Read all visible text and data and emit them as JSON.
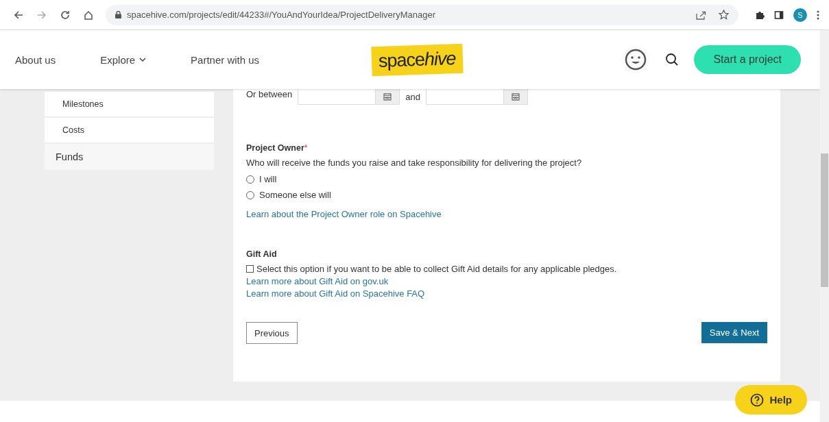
{
  "browser": {
    "url": "spacehive.com/projects/edit/44233#/YouAndYourIdea/ProjectDeliveryManager",
    "profile_initial": "S"
  },
  "header": {
    "nav": [
      {
        "label": "About us",
        "dropdown": false
      },
      {
        "label": "Explore",
        "dropdown": true
      },
      {
        "label": "Partner with us",
        "dropdown": false
      }
    ],
    "logo": {
      "plain": "space",
      "emphasis": "hive"
    },
    "cta": "Start a project"
  },
  "sidebar": {
    "items": [
      {
        "label": "Milestones",
        "kind": "sub"
      },
      {
        "label": "Costs",
        "kind": "sub"
      },
      {
        "label": "Funds",
        "kind": "main"
      }
    ]
  },
  "form": {
    "date_range": {
      "label": "Or between",
      "joiner": "and"
    },
    "project_owner": {
      "title": "Project Owner",
      "required_mark": "*",
      "question": "Who will receive the funds you raise and take responsibility for delivering the project?",
      "options": [
        {
          "label": "I will",
          "selected": false
        },
        {
          "label": "Someone else will",
          "selected": false
        }
      ],
      "link": "Learn about the Project Owner role on Spacehive"
    },
    "gift_aid": {
      "title": "Gift Aid",
      "checkbox": {
        "label": "Select this option if you want to be able to collect Gift Aid details for any applicable pledges.",
        "checked": false
      },
      "links": [
        "Learn more about Gift Aid on gov.uk",
        "Learn more about Gift Aid on Spacehive FAQ"
      ]
    },
    "buttons": {
      "previous": "Previous",
      "next": "Save & Next"
    }
  },
  "help": {
    "label": "Help"
  }
}
